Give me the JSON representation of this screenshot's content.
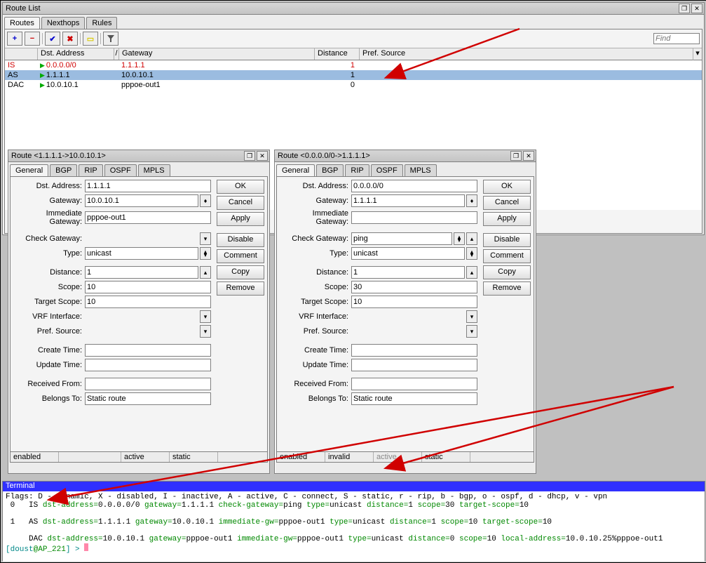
{
  "route_list_win": {
    "title": "Route List",
    "tabs": [
      "Routes",
      "Nexthops",
      "Rules"
    ],
    "active_tab": 0,
    "toolbar": {
      "add": "+",
      "del": "−",
      "ok": "✔",
      "x": "✖",
      "note": "▭",
      "filter": "▾"
    },
    "find_placeholder": "Find",
    "cols": {
      "flags": "",
      "dst": "Dst. Address",
      "gw": "Gateway",
      "dist": "Distance",
      "pref": "Pref. Source"
    },
    "rows": [
      {
        "flags": "IS",
        "dst": "0.0.0.0/0",
        "gw": "1.1.1.1",
        "dist": "1",
        "pref": "",
        "cls": "red"
      },
      {
        "flags": "AS",
        "dst": "1.1.1.1",
        "gw": "10.0.10.1",
        "dist": "1",
        "pref": "",
        "cls": "sel"
      },
      {
        "flags": "DAC",
        "dst": "10.0.10.1",
        "gw": "pppoe-out1",
        "dist": "0",
        "pref": "",
        "cls": "blk"
      }
    ]
  },
  "route1": {
    "title": "Route <1.1.1.1->10.0.10.1>",
    "tabs": [
      "General",
      "BGP",
      "RIP",
      "OSPF",
      "MPLS"
    ],
    "active_tab": 0,
    "fields": {
      "dst_l": "Dst. Address:",
      "dst": "1.1.1.1",
      "gw_l": "Gateway:",
      "gw": "10.0.10.1",
      "igw_l": "Immediate Gateway:",
      "igw": "pppoe-out1",
      "cg_l": "Check Gateway:",
      "cg": "",
      "type_l": "Type:",
      "type": "unicast",
      "dist_l": "Distance:",
      "dist": "1",
      "scope_l": "Scope:",
      "scope": "10",
      "ts_l": "Target Scope:",
      "ts": "10",
      "vrf_l": "VRF Interface:",
      "vrf": "",
      "pref_l": "Pref. Source:",
      "pref": "",
      "ct_l": "Create Time:",
      "ct": "",
      "ut_l": "Update Time:",
      "ut": "",
      "rf_l": "Received From:",
      "rf": "",
      "bt_l": "Belongs To:",
      "bt": "Static route"
    },
    "buttons": {
      "ok": "OK",
      "cancel": "Cancel",
      "apply": "Apply",
      "disable": "Disable",
      "comment": "Comment",
      "copy": "Copy",
      "remove": "Remove"
    },
    "status": {
      "enabled": "enabled",
      "invalid": "",
      "active": "active",
      "static": "static"
    }
  },
  "route2": {
    "title": "Route <0.0.0.0/0->1.1.1.1>",
    "tabs": [
      "General",
      "BGP",
      "RIP",
      "OSPF",
      "MPLS"
    ],
    "active_tab": 0,
    "fields": {
      "dst_l": "Dst. Address:",
      "dst": "0.0.0.0/0",
      "gw_l": "Gateway:",
      "gw": "1.1.1.1",
      "igw_l": "Immediate Gateway:",
      "igw": "",
      "cg_l": "Check Gateway:",
      "cg": "ping",
      "type_l": "Type:",
      "type": "unicast",
      "dist_l": "Distance:",
      "dist": "1",
      "scope_l": "Scope:",
      "scope": "30",
      "ts_l": "Target Scope:",
      "ts": "10",
      "vrf_l": "VRF Interface:",
      "vrf": "",
      "pref_l": "Pref. Source:",
      "pref": "",
      "ct_l": "Create Time:",
      "ct": "",
      "ut_l": "Update Time:",
      "ut": "",
      "rf_l": "Received From:",
      "rf": "",
      "bt_l": "Belongs To:",
      "bt": "Static route"
    },
    "buttons": {
      "ok": "OK",
      "cancel": "Cancel",
      "apply": "Apply",
      "disable": "Disable",
      "comment": "Comment",
      "copy": "Copy",
      "remove": "Remove"
    },
    "status": {
      "enabled": "enabled",
      "invalid": "invalid",
      "active": "active",
      "static": "static"
    }
  },
  "terminal": {
    "title": "Terminal",
    "flags_line": "Flags: D - dynamic, X - disabled, I - inactive, A - active, C - connect, S - static, r - rip, b - bgp, o - ospf, d - dhcp, v - vpn",
    "l0_prefix": " 0   IS ",
    "l0_a": "dst-address=",
    "l0_av": "0.0.0.0/0 ",
    "l0_b": "gateway=",
    "l0_bv": "1.1.1.1 ",
    "l0_c": "check-gateway=",
    "l0_cv": "ping ",
    "l0_d": "type=",
    "l0_dv": "unicast ",
    "l0_e": "distance=",
    "l0_ev": "1 ",
    "l0_f": "scope=",
    "l0_fv": "30 ",
    "l0_g": "target-scope=",
    "l0_gv": "10",
    "l1_prefix": " 1   AS ",
    "l1_a": "dst-address=",
    "l1_av": "1.1.1.1 ",
    "l1_b": "gateway=",
    "l1_bv": "10.0.10.1 ",
    "l1_c": "immediate-gw=",
    "l1_cv": "pppoe-out1 ",
    "l1_d": "type=",
    "l1_dv": "unicast ",
    "l1_e": "distance=",
    "l1_ev": "1 ",
    "l1_f": "scope=",
    "l1_fv": "10 ",
    "l1_g": "target-scope=",
    "l1_gv": "10",
    "l2_prefix": "     DAC ",
    "l2_a": "dst-address=",
    "l2_av": "10.0.10.1 ",
    "l2_b": "gateway=",
    "l2_bv": "pppoe-out1 ",
    "l2_c": "immediate-gw=",
    "l2_cv": "pppoe-out1 ",
    "l2_d": "type=",
    "l2_dv": "unicast ",
    "l2_e": "distance=",
    "l2_ev": "0 ",
    "l2_f": "scope=",
    "l2_fv": "10 ",
    "l2_g": "local-address=",
    "l2_gv": "10.0.10.25%pppoe-out1",
    "prompt_open": "[",
    "prompt_user": "doust",
    "prompt_at": "@",
    "prompt_host": "AP_221",
    "prompt_close": "] > "
  }
}
